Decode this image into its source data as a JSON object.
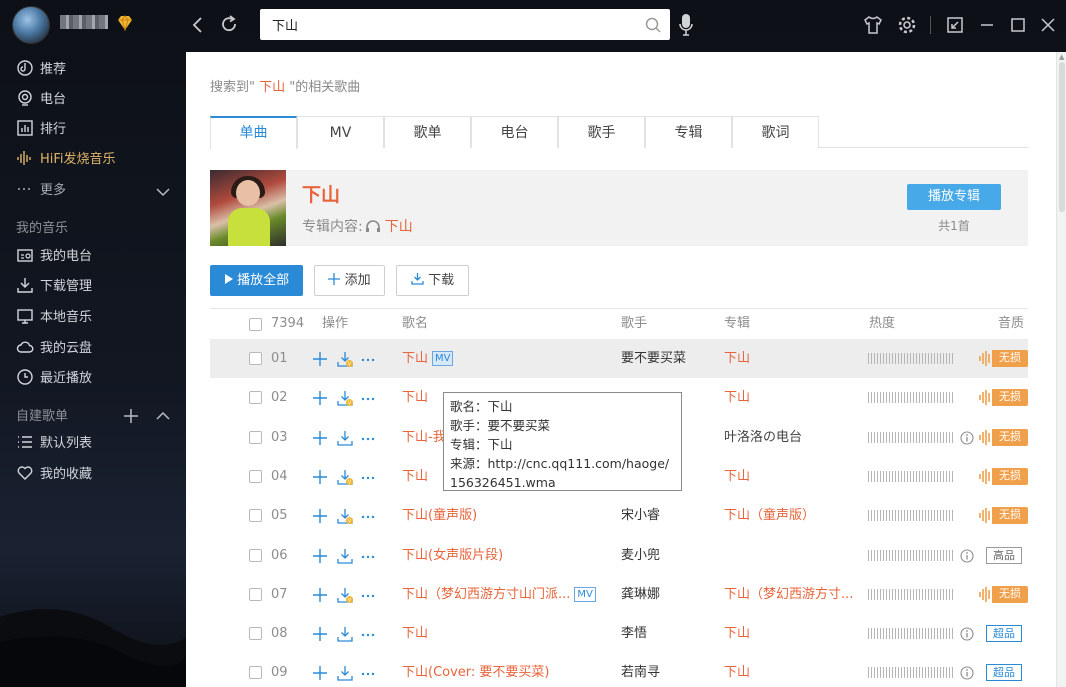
{
  "search": {
    "query": "下山"
  },
  "sidebar": {
    "items": [
      {
        "label": "推荐",
        "icon": "recommend-icon"
      },
      {
        "label": "电台",
        "icon": "radio-icon"
      },
      {
        "label": "排行",
        "icon": "chart-icon"
      },
      {
        "label": "HiFi发烧音乐",
        "icon": "hifi-icon"
      },
      {
        "label": "更多",
        "icon": "more-dots-icon"
      }
    ],
    "my_music_heading": "我的音乐",
    "my_music": [
      {
        "label": "我的电台",
        "icon": "my-radio-icon"
      },
      {
        "label": "下载管理",
        "icon": "download-icon"
      },
      {
        "label": "本地音乐",
        "icon": "monitor-icon"
      },
      {
        "label": "我的云盘",
        "icon": "cloud-icon"
      },
      {
        "label": "最近播放",
        "icon": "clock-icon"
      }
    ],
    "playlist_heading": "自建歌单",
    "playlists": [
      {
        "label": "默认列表",
        "icon": "list-icon"
      },
      {
        "label": "我的收藏",
        "icon": "heart-icon"
      }
    ]
  },
  "content": {
    "hint_prefix": "搜索到\"",
    "hint_keyword": " 下山 ",
    "hint_suffix": "\"的相关歌曲",
    "tabs": [
      "单曲",
      "MV",
      "歌单",
      "电台",
      "歌手",
      "专辑",
      "歌词"
    ],
    "album": {
      "title": "下山",
      "sub_label": "专辑内容:",
      "sub_link": "下山",
      "play_button": "播放专辑",
      "count": "共1首"
    },
    "actions": {
      "play_all": "播放全部",
      "add": "添加",
      "download": "下载"
    },
    "table": {
      "headers": {
        "count": "7394",
        "ops": "操作",
        "song": "歌名",
        "singer": "歌手",
        "album": "专辑",
        "heat": "热度",
        "quality": "音质"
      },
      "rows": [
        {
          "num": "01",
          "song": "下山",
          "mv": "MV",
          "singer": "要不要买菜",
          "album": "下山",
          "quality": "无损",
          "qtype": "lossless",
          "info": false,
          "dl_badge": true
        },
        {
          "num": "02",
          "song": "下山",
          "mv": "",
          "singer": "",
          "album": "下山",
          "quality": "无损",
          "qtype": "lossless",
          "info": false,
          "dl_badge": true
        },
        {
          "num": "03",
          "song": "下山-我",
          "mv": "",
          "singer": "",
          "album": "叶洛洛の电台",
          "quality": "无损",
          "qtype": "lossless",
          "info": true,
          "dl_badge": false
        },
        {
          "num": "04",
          "song": "下山",
          "mv": "",
          "singer": "",
          "album": "下山",
          "quality": "无损",
          "qtype": "lossless",
          "info": false,
          "dl_badge": true
        },
        {
          "num": "05",
          "song": "下山(童声版)",
          "mv": "",
          "singer": "宋小睿",
          "album": "下山（童声版）",
          "quality": "无损",
          "qtype": "lossless",
          "info": false,
          "dl_badge": true
        },
        {
          "num": "06",
          "song": "下山(女声版片段)",
          "mv": "",
          "singer": "麦小兜",
          "album": "",
          "quality": "高品",
          "qtype": "tag",
          "info": true,
          "dl_badge": false
        },
        {
          "num": "07",
          "song": "下山（梦幻西游方寸山门派...",
          "mv": "MV",
          "singer": "龚琳娜",
          "album": "下山（梦幻西游方寸...",
          "quality": "无损",
          "qtype": "lossless",
          "info": false,
          "dl_badge": true
        },
        {
          "num": "08",
          "song": "下山",
          "mv": "",
          "singer": "李悟",
          "album": "下山",
          "quality": "超品",
          "qtype": "tag-blue",
          "info": true,
          "dl_badge": false
        },
        {
          "num": "09",
          "song": "下山(Cover: 要不要买菜)",
          "mv": "",
          "singer": "若南寻",
          "album": "下山",
          "quality": "超品",
          "qtype": "tag-blue",
          "info": true,
          "dl_badge": false
        }
      ]
    },
    "tooltip": {
      "line1": "歌名：下山",
      "line2": "歌手：要不要买菜",
      "line3": "专辑：下山",
      "line4": "来源：http://cnc.qq111.com/haoge/",
      "line5": "156326451.wma"
    }
  },
  "colors": {
    "accent_orange": "#e8643b",
    "accent_blue": "#2a8ad6",
    "lossless_badge": "#f0a04a"
  }
}
